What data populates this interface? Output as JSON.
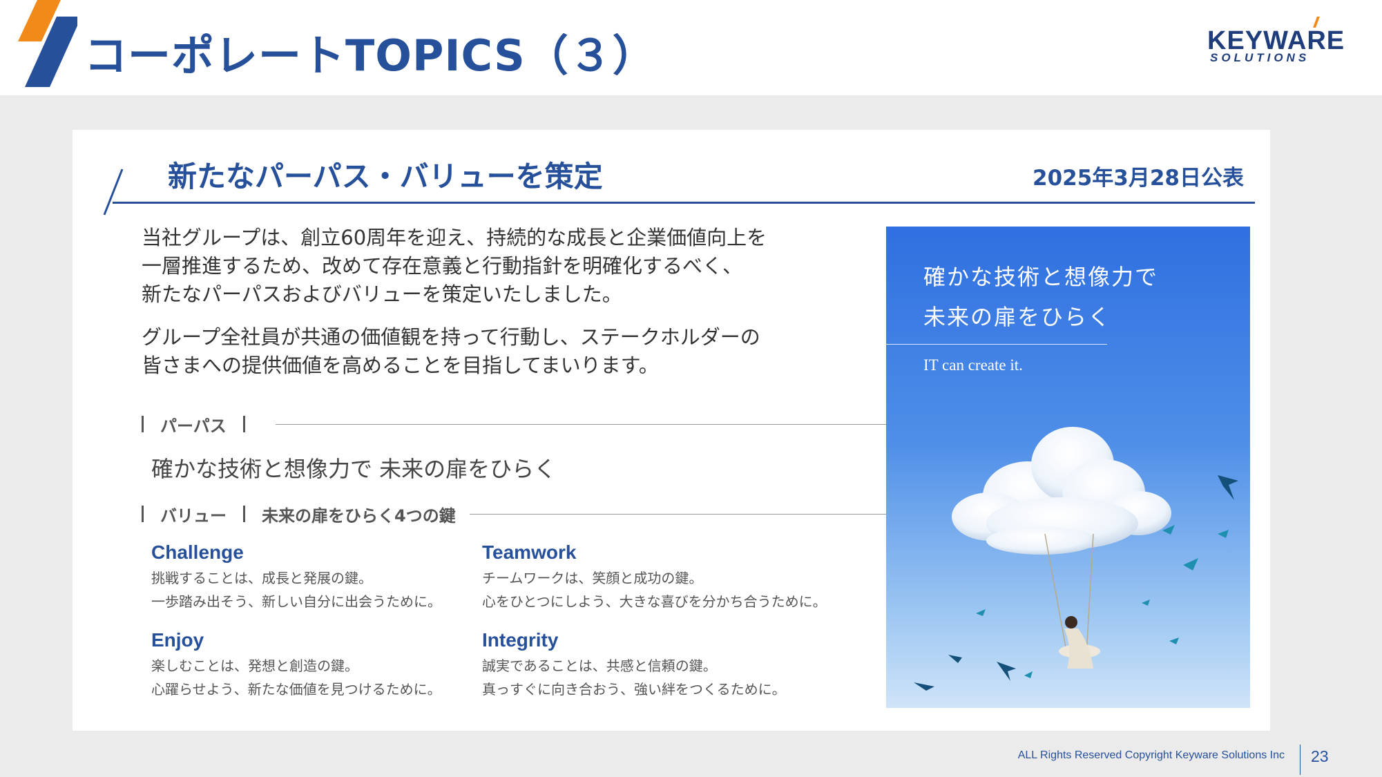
{
  "header": {
    "title": "コーポレートTOPICS（３）",
    "logo_main": "KEYWARE",
    "logo_sub": "SOLUTIONS"
  },
  "section": {
    "title": "新たなパーパス・バリューを策定",
    "date": "2025年3月28日公表"
  },
  "body": {
    "paragraph1": [
      "当社グループは、創立60周年を迎え、持続的な成長と企業価値向上を",
      "一層推進するため、改めて存在意義と行動指針を明確化するべく、",
      "新たなパーパスおよびバリューを策定いたしました。"
    ],
    "paragraph2": [
      "グループ全社員が共通の価値観を持って行動し、ステークホルダーの",
      "皆さまへの提供価値を高めることを目指してまいります。"
    ]
  },
  "purpose": {
    "heading": "パーパス",
    "text": "確かな技術と想像力で 未来の扉をひらく"
  },
  "values": {
    "heading": "バリュー",
    "subheading": "未来の扉をひらく4つの鍵",
    "items": [
      {
        "name": "Challenge",
        "line1": "挑戦することは、成長と発展の鍵。",
        "line2": "一歩踏み出そう、新しい自分に出会うために。"
      },
      {
        "name": "Teamwork",
        "line1": "チームワークは、笑顔と成功の鍵。",
        "line2": "心をひとつにしよう、大きな喜びを分かち合うために。"
      },
      {
        "name": "Enjoy",
        "line1": "楽しむことは、発想と創造の鍵。",
        "line2": "心躍らせよう、新たな価値を見つけるために。"
      },
      {
        "name": "Integrity",
        "line1": "誠実であることは、共感と信頼の鍵。",
        "line2": "真っすぐに向き合おう、強い絆をつくるために。"
      }
    ]
  },
  "visual": {
    "line1": "確かな技術と想像力で",
    "line2": "未来の扉をひらく",
    "tagline": "IT can create it."
  },
  "footer": {
    "copyright": "ALL Rights Reserved Copyright Keyware Solutions Inc",
    "page": "23"
  },
  "colors": {
    "brand_blue": "#27509b",
    "accent_orange": "#f28a1a",
    "background": "#ebebeb",
    "sky_top": "#2f6fe0",
    "sky_bottom": "#cfe4f8"
  }
}
